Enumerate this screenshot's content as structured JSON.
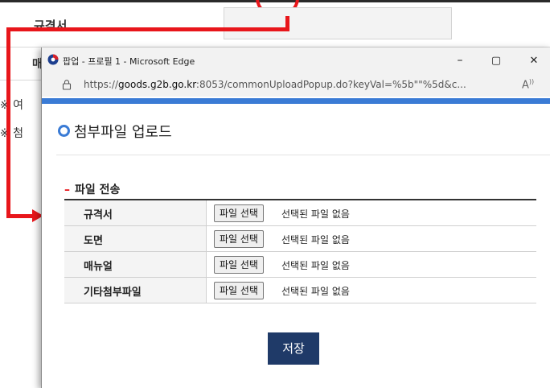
{
  "background": {
    "row1_label": "규격서",
    "row2_label": "매",
    "note1": "※ 여",
    "note2": "※ 첨"
  },
  "window": {
    "title": "팝업 - 프로필 1 - Microsoft Edge",
    "minimize": "–",
    "maximize": "▢",
    "close": "✕",
    "url_prefix": "https://",
    "url_domain": "goods.g2b.go.kr",
    "url_rest": ":8053/commonUploadPopup.do?keyVal=%5b\"\"%5d&c...",
    "read_aloud": "A"
  },
  "popup": {
    "page_title": "첨부파일 업로드",
    "section_dash": "–",
    "section_title": "파일 전송",
    "rows": [
      {
        "label": "규격서",
        "button": "파일 선택",
        "status": "선택된 파일 없음"
      },
      {
        "label": "도면",
        "button": "파일 선택",
        "status": "선택된 파일 없음"
      },
      {
        "label": "매뉴얼",
        "button": "파일 선택",
        "status": "선택된 파일 없음"
      },
      {
        "label": "기타첨부파일",
        "button": "파일 선택",
        "status": "선택된 파일 없음"
      }
    ],
    "save_label": "저장"
  },
  "colors": {
    "annotation_red": "#e8161b",
    "accent_blue": "#3a7bd5",
    "save_navy": "#1f3a68"
  }
}
